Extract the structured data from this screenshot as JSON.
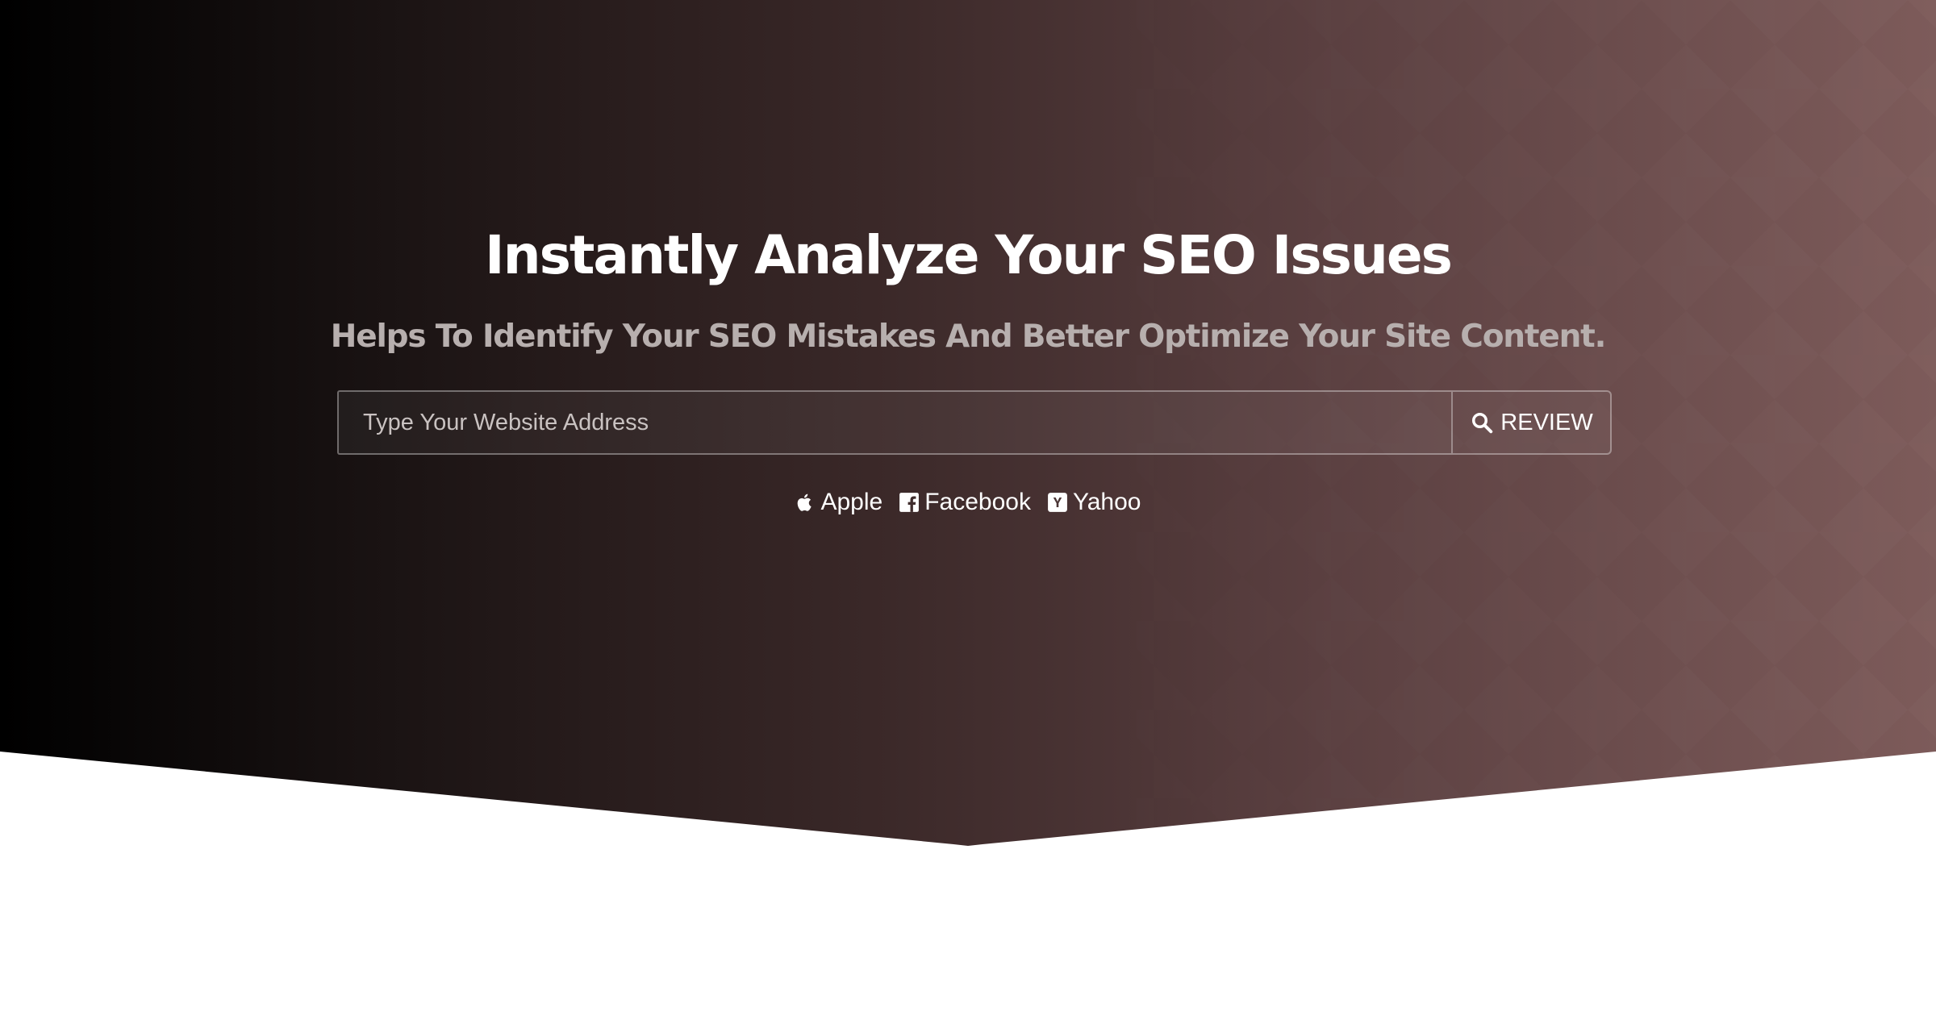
{
  "hero": {
    "title": "Instantly Analyze Your SEO Issues",
    "subtitle": "Helps To Identify Your SEO Mistakes And Better Optimize Your Site Content."
  },
  "search": {
    "placeholder": "Type Your Website Address",
    "value": "",
    "button_label": "REVIEW",
    "button_icon": "search-icon"
  },
  "examples": [
    {
      "label": "Apple",
      "icon": "apple-icon"
    },
    {
      "label": "Facebook",
      "icon": "facebook-icon"
    },
    {
      "label": "Yahoo",
      "icon": "yahoo-icon"
    }
  ],
  "colors": {
    "gradient_start": "#000000",
    "gradient_end": "#7d5b5a",
    "title": "#ffffff",
    "subtitle": "#b7afae",
    "page_background": "#ffffff"
  }
}
